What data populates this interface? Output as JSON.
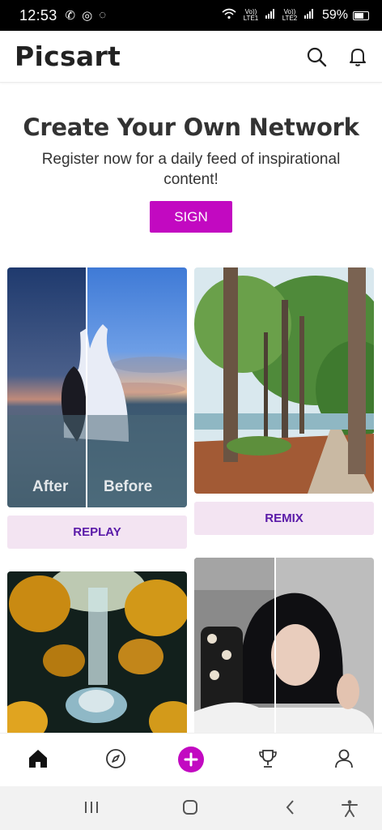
{
  "status_bar": {
    "time": "12:53",
    "lte1": "Vo)) LTE1",
    "lte2": "Vo)) LTE2",
    "battery": "59%"
  },
  "header": {
    "logo": "Picsart",
    "icons": [
      "search-icon",
      "bell-icon"
    ]
  },
  "promo": {
    "title": "Create Your Own Network",
    "subtitle": "Register now for a daily feed of inspirational content!",
    "signup_label": "SIGN UP",
    "accent": "#c209c1"
  },
  "feed": {
    "cards": [
      {
        "after_label": "After",
        "before_label": "Before",
        "action_label": "REPLAY"
      },
      {
        "action_label": "REMIX"
      },
      {},
      {}
    ]
  },
  "bottom_nav": {
    "items": [
      "home-icon",
      "explore-icon",
      "create-icon",
      "challenges-icon",
      "profile-icon"
    ],
    "active": "home-icon"
  }
}
